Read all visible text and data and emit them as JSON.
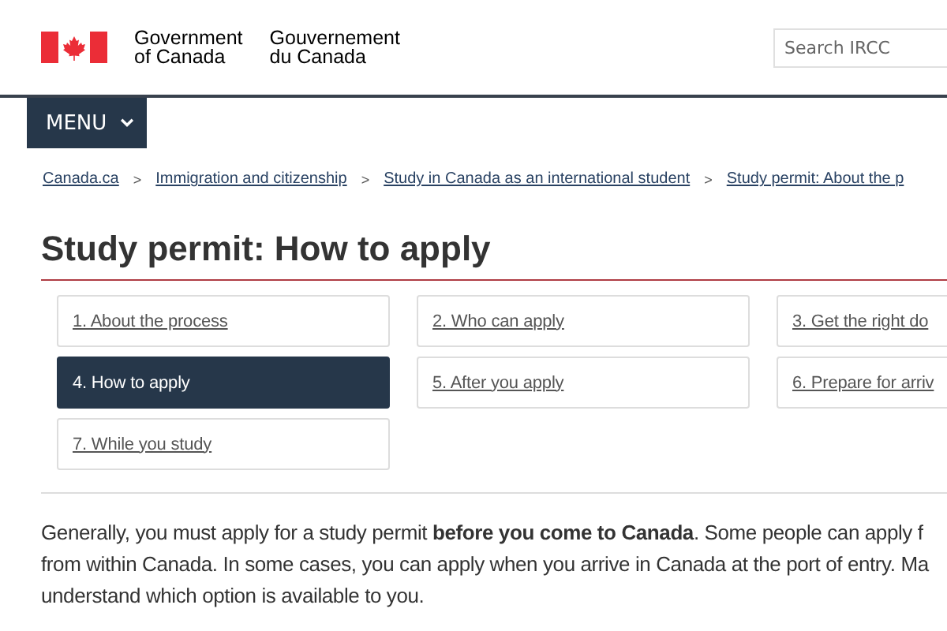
{
  "header": {
    "org_en": [
      "Government",
      "of Canada"
    ],
    "org_fr": [
      "Gouvernement",
      "du Canada"
    ],
    "search": {
      "placeholder": "Search IRCC"
    }
  },
  "menu": {
    "label": "MENU"
  },
  "breadcrumbs": [
    "Canada.ca",
    "Immigration and citizenship",
    "Study in Canada as an international student",
    "Study permit: About the p"
  ],
  "breadcrumb_separator": ">",
  "title": "Study permit: How to apply",
  "steps": [
    {
      "label": "1. About the process",
      "selected": false
    },
    {
      "label": "2. Who can apply",
      "selected": false
    },
    {
      "label": "3. Get the right do",
      "selected": false
    },
    {
      "label": "4. How to apply",
      "selected": true
    },
    {
      "label": "5. After you apply",
      "selected": false
    },
    {
      "label": "6. Prepare for arriv",
      "selected": false
    },
    {
      "label": "7. While you study",
      "selected": false
    }
  ],
  "paragraph": [
    "Generally, you must apply for a study permit **before you come to Canada**. Some people can apply f",
    "from within Canada. In some cases, you can apply when you arrive in Canada at the port of entry. Ma",
    "understand which option is available to you."
  ]
}
